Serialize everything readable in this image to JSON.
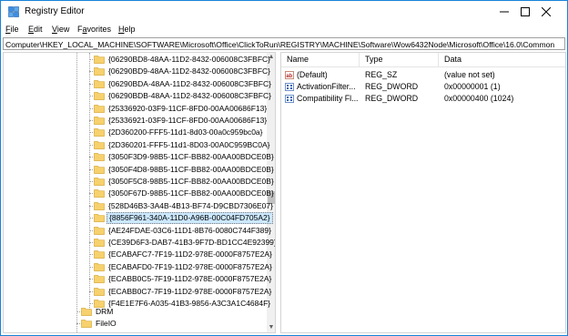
{
  "window": {
    "title": "Registry Editor"
  },
  "menu": [
    {
      "label": "File",
      "accel": "F",
      "rest": "ile"
    },
    {
      "label": "Edit",
      "accel": "E",
      "rest": "dit"
    },
    {
      "label": "View",
      "accel": "V",
      "rest": "iew"
    },
    {
      "label": "Favorites",
      "accel": "a",
      "pre": "F",
      "rest": "vorites"
    },
    {
      "label": "Help",
      "accel": "H",
      "rest": "elp"
    }
  ],
  "address": "Computer\\HKEY_LOCAL_MACHINE\\SOFTWARE\\Microsoft\\Office\\ClickToRun\\REGISTRY\\MACHINE\\Software\\Wow6432Node\\Microsoft\\Office\\16.0\\Common",
  "tree": {
    "items": [
      "{06290BD8-48AA-11D2-8432-006008C3FBFC}",
      "{06290BD9-48AA-11D2-8432-006008C3FBFC}",
      "{06290BDA-48AA-11D2-8432-006008C3FBFC}",
      "{06290BDB-48AA-11D2-8432-006008C3FBFC}",
      "{25336920-03F9-11CF-8FD0-00AA00686F13}",
      "{25336921-03F9-11CF-8FD0-00AA00686F13}",
      "{2D360200-FFF5-11d1-8d03-00a0c959bc0a}",
      "{2D360201-FFF5-11d1-8D03-00A0C959BC0A}",
      "{3050F3D9-98B5-11CF-BB82-00AA00BDCE0B}",
      "{3050F4D8-98B5-11CF-BB82-00AA00BDCE0B}",
      "{3050F5C8-98B5-11CF-BB82-00AA00BDCE0B}",
      "{3050F67D-98B5-11CF-BB82-00AA00BDCE0B}",
      "{528D46B3-3A4B-4B13-BF74-D9CBD7306E07}",
      "{8856F961-340A-11D0-A96B-00C04FD705A2}",
      "{AE24FDAE-03C6-11D1-8B76-0080C744F389}",
      "{CE39D6F3-DAB7-41B3-9F7D-BD1CC4E92399}",
      "{ECABAFC7-7F19-11D2-978E-0000F8757E2A}",
      "{ECABAFD0-7F19-11D2-978E-0000F8757E2A}",
      "{ECABB0C5-7F19-11D2-978E-0000F8757E2A}",
      "{ECABB0C7-7F19-11D2-978E-0000F8757E2A}",
      "{F4E1E7F6-A035-41B3-9856-A3C3A1C4684F}"
    ],
    "selected_index": 13,
    "parent_items": [
      "DRM",
      "FileIO"
    ]
  },
  "values": {
    "headers": {
      "name": "Name",
      "type": "Type",
      "data": "Data"
    },
    "rows": [
      {
        "icon": "string-value-icon",
        "name": "(Default)",
        "type": "REG_SZ",
        "data": "(value not set)"
      },
      {
        "icon": "dword-value-icon",
        "name": "ActivationFilter...",
        "type": "REG_DWORD",
        "data": "0x00000001 (1)"
      },
      {
        "icon": "dword-value-icon",
        "name": "Compatibility Fl...",
        "type": "REG_DWORD",
        "data": "0x00000400 (1024)"
      }
    ]
  },
  "colors": {
    "folder": "#f6d16d",
    "selection": "#cce8ff",
    "border": "#1883d7"
  }
}
